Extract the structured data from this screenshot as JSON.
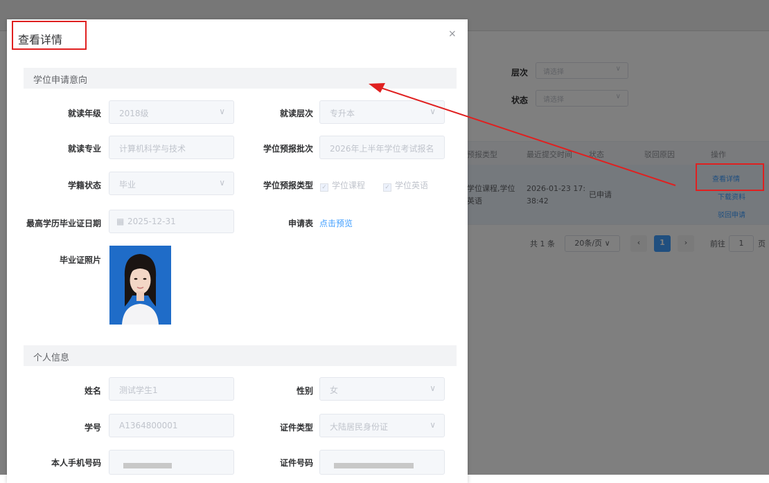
{
  "background": {
    "filters": [
      {
        "label": "层次",
        "placeholder": "请选择"
      },
      {
        "label": "状态",
        "placeholder": "请选择"
      }
    ],
    "table": {
      "headers": [
        "预报类型",
        "最近提交时间",
        "状态",
        "驳回原因",
        "操作"
      ],
      "row": {
        "type_line1": "学位课程,学位",
        "type_line2": "英语",
        "time_line1": "2026-01-23 17:",
        "time_line2": "38:42",
        "status": "已申请",
        "actions": [
          "查看详情",
          "下载资料",
          "驳回申请"
        ]
      }
    },
    "pagination": {
      "total": "共 1 条",
      "page_size": "20条/页",
      "prev": "‹",
      "current_page": "1",
      "next": "›",
      "goto_label": "前往",
      "goto_value": "1",
      "goto_suffix": "页"
    }
  },
  "dialog": {
    "title": "查看详情",
    "close_icon": "×",
    "sections": {
      "intent": "学位申请意向",
      "personal": "个人信息"
    },
    "fields": {
      "grade": {
        "label": "就读年级",
        "value": "2018级"
      },
      "level": {
        "label": "就读层次",
        "value": "专升本"
      },
      "major": {
        "label": "就读专业",
        "value": "计算机科学与技术"
      },
      "batch": {
        "label": "学位预报批次",
        "value": "2026年上半年学位考试报名"
      },
      "status": {
        "label": "学籍状态",
        "value": "毕业"
      },
      "report_type": {
        "label": "学位预报类型",
        "options": [
          "学位课程",
          "学位英语"
        ]
      },
      "grad_date": {
        "label": "最高学历毕业证日期",
        "value": "2025-12-31"
      },
      "form": {
        "label": "申请表",
        "link": "点击预览"
      },
      "photo": {
        "label": "毕业证照片"
      },
      "name": {
        "label": "姓名",
        "value": "测试学生1"
      },
      "gender": {
        "label": "性别",
        "value": "女"
      },
      "student_id": {
        "label": "学号",
        "value": "A1364800001"
      },
      "id_type": {
        "label": "证件类型",
        "value": "大陆居民身份证"
      },
      "phone": {
        "label": "本人手机号码"
      },
      "id_number": {
        "label": "证件号码"
      }
    }
  },
  "colors": {
    "annotation": "#e02020",
    "link": "#409eff",
    "primary": "#409eff"
  }
}
